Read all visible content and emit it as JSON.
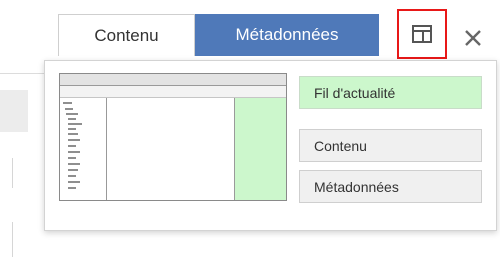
{
  "tabs": {
    "contenu_label": "Contenu",
    "metadonnees_label": "Métadonnées",
    "active": "Métadonnées"
  },
  "toolbar": {
    "layout_icon": "layout-panels-icon",
    "close_icon": "close-icon"
  },
  "layout_menu": {
    "preview": "layout-preview-thumbnail",
    "options": [
      {
        "label": "Fil d'actualité",
        "selected": true
      },
      {
        "label": "Contenu",
        "selected": false
      },
      {
        "label": "Métadonnées",
        "selected": false
      }
    ]
  },
  "colors": {
    "tab_active_bg": "#4f79b9",
    "highlight_border": "#e81818",
    "selected_option_bg": "#ccf7cc"
  }
}
